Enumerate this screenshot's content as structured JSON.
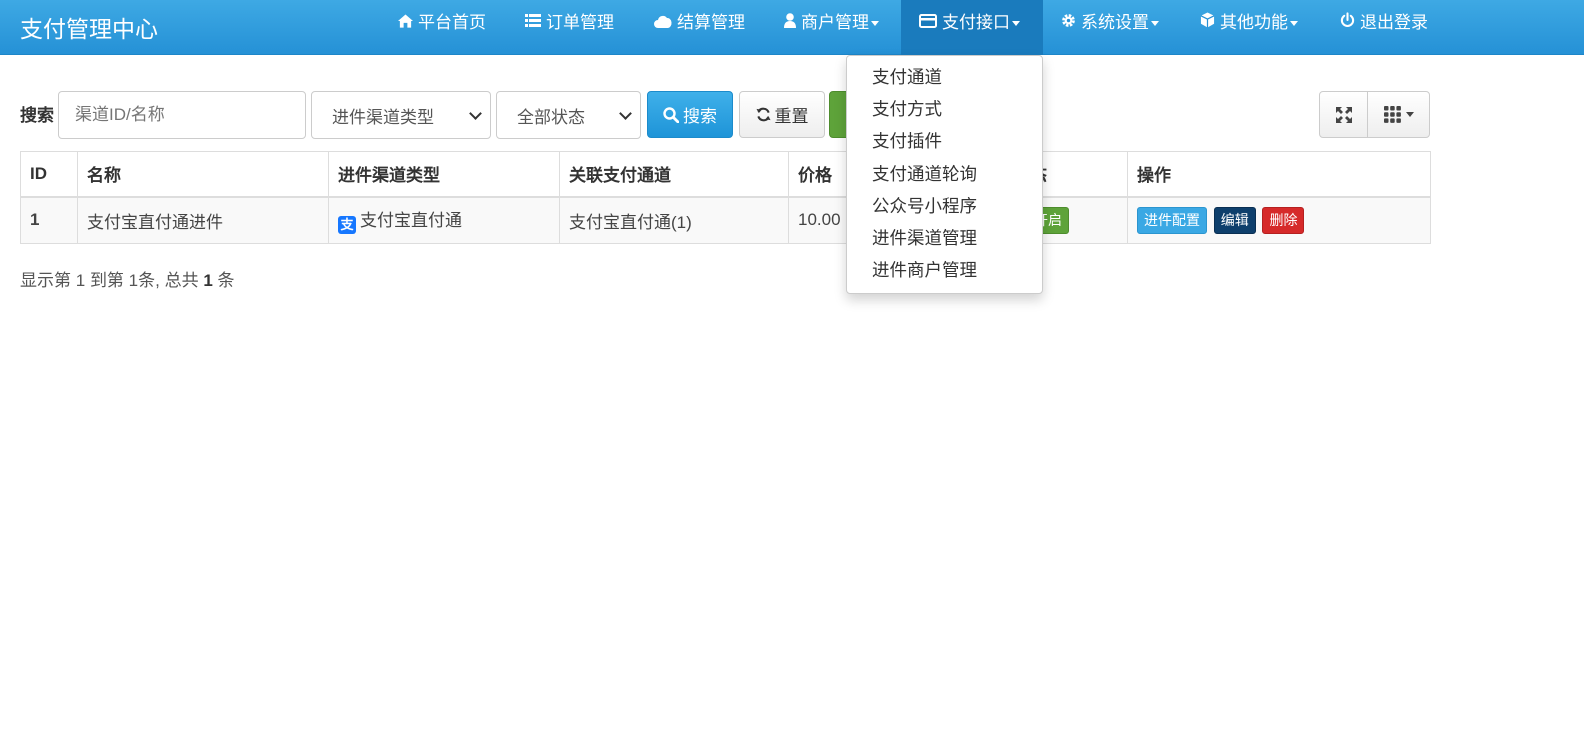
{
  "header": {
    "brand": "支付管理中心",
    "nav": [
      {
        "label": "平台首页",
        "icon": "home-icon"
      },
      {
        "label": "订单管理",
        "icon": "list-icon"
      },
      {
        "label": "结算管理",
        "icon": "cloud-icon"
      },
      {
        "label": "商户管理",
        "icon": "user-icon"
      },
      {
        "label": "支付接口",
        "icon": "credit-card-icon"
      },
      {
        "label": "系统设置",
        "icon": "gear-icon"
      },
      {
        "label": "其他功能",
        "icon": "cube-icon"
      },
      {
        "label": "退出登录",
        "icon": "power-icon"
      }
    ]
  },
  "dropdown": {
    "items": [
      "支付通道",
      "支付方式",
      "支付插件",
      "支付通道轮询",
      "公众号小程序",
      "进件渠道管理",
      "进件商户管理"
    ]
  },
  "toolbar": {
    "search_label": "搜索",
    "search_placeholder": "渠道ID/名称",
    "channel_type_select": "进件渠道类型",
    "status_select": "全部状态",
    "search_button": "搜索",
    "reset_button": "重置"
  },
  "table": {
    "columns": [
      "ID",
      "名称",
      "进件渠道类型",
      "关联支付通道",
      "价格",
      "状态",
      "操作"
    ],
    "rows": [
      {
        "id": "1",
        "name": "支付宝直付通进件",
        "channel_type": "支付宝直付通",
        "channel_icon_char": "支",
        "linked_channel": "支付宝直付通(1)",
        "price": "10.00",
        "status": "开启",
        "actions": [
          "进件配置",
          "编辑",
          "删除"
        ]
      }
    ]
  },
  "pagination": {
    "prefix": "显示第",
    "start": "1",
    "to": "到第",
    "end": "1",
    "mid": "条, 总共",
    "total": "1",
    "suffix": "条"
  },
  "colors": {
    "navbar": "#2a9be0",
    "primary": "#1e94d8",
    "success": "#5ea33a",
    "danger": "#d62a2a",
    "navy": "#0e3f6c"
  }
}
